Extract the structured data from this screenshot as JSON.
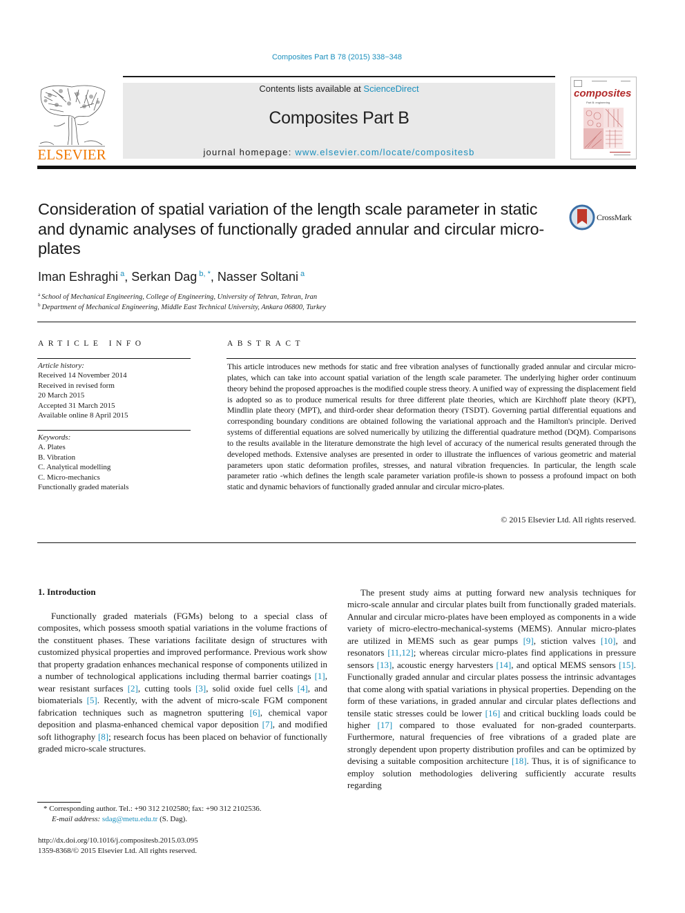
{
  "journal_citation": "Composites Part B 78 (2015) 338−348",
  "header": {
    "publisher_logo_text": "ELSEVIER",
    "publisher_logo_icon": "elsevier-tree-icon",
    "contents_prefix": "Contents lists available at ",
    "contents_link": "ScienceDirect",
    "journal_title": "Composites Part B",
    "homepage_prefix": "journal homepage: ",
    "homepage_link": "www.elsevier.com/locate/compositesb",
    "cover": {
      "title": "composites",
      "subtitle": "Part B: engineering"
    },
    "colors": {
      "link": "#1a8fbd",
      "elsevier_orange": "#f07800",
      "cover_red": "#b22a2a",
      "masthead_bg": "#e9e9e9"
    }
  },
  "article": {
    "title": "Consideration of spatial variation of the length scale parameter in static and dynamic analyses of functionally graded annular and circular micro-plates",
    "crossmark_label": "CrossMark",
    "authors": [
      {
        "name": "Iman Eshraghi",
        "sup": "a",
        "sep": ", "
      },
      {
        "name": "Serkan Dag",
        "sup": "b, *",
        "sep": ", "
      },
      {
        "name": "Nasser Soltani",
        "sup": "a",
        "sep": ""
      }
    ],
    "affiliations": [
      {
        "key": "a",
        "text": "School of Mechanical Engineering, College of Engineering, University of Tehran, Tehran, Iran"
      },
      {
        "key": "b",
        "text": "Department of Mechanical Engineering, Middle East Technical University, Ankara 06800, Turkey"
      }
    ]
  },
  "article_info": {
    "heading": "ARTICLE INFO",
    "history_label": "Article history:",
    "history": [
      "Received 14 November 2014",
      "Received in revised form",
      "20 March 2015",
      "Accepted 31 March 2015",
      "Available online 8 April 2015"
    ],
    "keywords_label": "Keywords:",
    "keywords": [
      "A. Plates",
      "B. Vibration",
      "C. Analytical modelling",
      "C. Micro-mechanics",
      "Functionally graded materials"
    ]
  },
  "abstract": {
    "heading": "ABSTRACT",
    "text": "This article introduces new methods for static and free vibration analyses of functionally graded annular and circular micro-plates, which can take into account spatial variation of the length scale parameter. The underlying higher order continuum theory behind the proposed approaches is the modified couple stress theory. A unified way of expressing the displacement field is adopted so as to produce numerical results for three different plate theories, which are Kirchhoff plate theory (KPT), Mindlin plate theory (MPT), and third-order shear deformation theory (TSDT). Governing partial differential equations and corresponding boundary conditions are obtained following the variational approach and the Hamilton's principle. Derived systems of differential equations are solved numerically by utilizing the differential quadrature method (DQM). Comparisons to the results available in the literature demonstrate the high level of accuracy of the numerical results generated through the developed methods. Extensive analyses are presented in order to illustrate the influences of various geometric and material parameters upon static deformation profiles, stresses, and natural vibration frequencies. In particular, the length scale parameter ratio -which defines the length scale parameter variation profile-is shown to possess a profound impact on both static and dynamic behaviors of functionally graded annular and circular micro-plates.",
    "copyright": "© 2015 Elsevier Ltd. All rights reserved."
  },
  "body": {
    "section_heading": "1.  Introduction",
    "left_paragraph": [
      {
        "t": "Functionally graded materials (FGMs) belong to a special class of composites, which possess smooth spatial variations in the volume fractions of the constituent phases. These variations facilitate design of structures with customized physical properties and improved performance. Previous work show that property gradation enhances mechanical response of components utilized in a number of technological applications including thermal barrier coatings "
      },
      {
        "ref": "[1]"
      },
      {
        "t": ", wear resistant surfaces "
      },
      {
        "ref": "[2]"
      },
      {
        "t": ", cutting tools "
      },
      {
        "ref": "[3]"
      },
      {
        "t": ", solid oxide fuel cells "
      },
      {
        "ref": "[4]"
      },
      {
        "t": ", and biomaterials "
      },
      {
        "ref": "[5]"
      },
      {
        "t": ". Recently, with the advent of micro-scale FGM component fabrication techniques such as magnetron sputtering "
      },
      {
        "ref": "[6]"
      },
      {
        "t": ", chemical vapor deposition and plasma-enhanced chemical vapor deposition "
      },
      {
        "ref": "[7]"
      },
      {
        "t": ", and modified soft lithography "
      },
      {
        "ref": "[8]"
      },
      {
        "t": "; research focus has been placed on behavior of functionally graded micro-scale structures."
      }
    ],
    "right_paragraph": [
      {
        "t": "The present study aims at putting forward new analysis techniques for micro-scale annular and circular plates built from functionally graded materials. Annular and circular micro-plates have been employed as components in a wide variety of micro-electro-mechanical-systems (MEMS). Annular micro-plates are utilized in MEMS such as gear pumps "
      },
      {
        "ref": "[9]"
      },
      {
        "t": ", stiction valves "
      },
      {
        "ref": "[10]"
      },
      {
        "t": ", and resonators "
      },
      {
        "ref": "[11,12]"
      },
      {
        "t": "; whereas circular micro-plates find applications in pressure sensors "
      },
      {
        "ref": "[13]"
      },
      {
        "t": ", acoustic energy harvesters "
      },
      {
        "ref": "[14]"
      },
      {
        "t": ", and optical MEMS sensors "
      },
      {
        "ref": "[15]"
      },
      {
        "t": ". Functionally graded annular and circular plates possess the intrinsic advantages that come along with spatial variations in physical properties. Depending on the form of these variations, in graded annular and circular plates deflections and tensile static stresses could be lower "
      },
      {
        "ref": "[16]"
      },
      {
        "t": " and critical buckling loads could be higher "
      },
      {
        "ref": "[17]"
      },
      {
        "t": " compared to those evaluated for non-graded counterparts. Furthermore, natural frequencies of free vibrations of a graded plate are strongly dependent upon property distribution profiles and can be optimized by devising a suitable composition architecture "
      },
      {
        "ref": "[18]"
      },
      {
        "t": ". Thus, it is of significance to employ solution methodologies delivering sufficiently accurate results regarding"
      }
    ]
  },
  "footnotes": {
    "corresponding": "* Corresponding author. Tel.: +90 312 2102580; fax: +90 312 2102536.",
    "email_label": "E-mail address: ",
    "email": "sdag@metu.edu.tr",
    "email_suffix": " (S. Dag).",
    "doi": "http://dx.doi.org/10.1016/j.compositesb.2015.03.095",
    "issn": "1359-8368/© 2015 Elsevier Ltd. All rights reserved."
  }
}
